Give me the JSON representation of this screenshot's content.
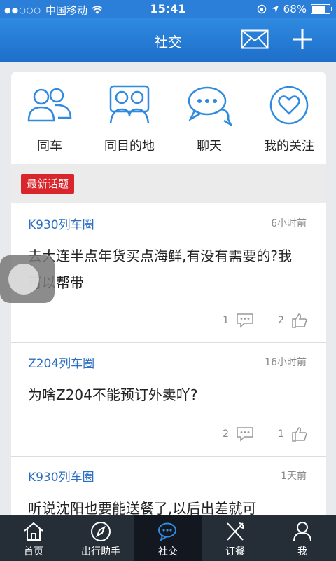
{
  "status_bar": {
    "carrier": "中国移动",
    "time": "15:41",
    "battery": "68%"
  },
  "navbar": {
    "title": "社交"
  },
  "shortcuts": [
    {
      "label": "同车",
      "icon": "people-icon"
    },
    {
      "label": "同目的地",
      "icon": "pair-icon"
    },
    {
      "label": "聊天",
      "icon": "chat-bubbles-icon"
    },
    {
      "label": "我的关注",
      "icon": "heart-icon"
    }
  ],
  "section": {
    "tag": "最新话题"
  },
  "posts": [
    {
      "group": "K930列车圈",
      "time": "6小时前",
      "text": "去大连半点年货买点海鲜,有没有需要的?我可以帮带",
      "comments": "1",
      "likes": "2"
    },
    {
      "group": "Z204列车圈",
      "time": "16小时前",
      "text": "为啥Z204不能预订外卖吖?",
      "comments": "2",
      "likes": "1"
    },
    {
      "group": "K930列车圈",
      "time": "1天前",
      "text": "听说沈阳也要能送餐了,以后出差就可",
      "comments": "",
      "likes": ""
    }
  ],
  "tabbar": [
    {
      "label": "首页",
      "icon": "home-icon"
    },
    {
      "label": "出行助手",
      "icon": "compass-icon"
    },
    {
      "label": "社交",
      "icon": "chat-icon"
    },
    {
      "label": "订餐",
      "icon": "fork-knife-icon"
    },
    {
      "label": "我",
      "icon": "person-icon"
    }
  ],
  "colors": {
    "nav_blue": "#2b7fd8",
    "link_blue": "#2c6fc2",
    "tag_red": "#d9262c",
    "tabbar_bg": "#252d37"
  }
}
